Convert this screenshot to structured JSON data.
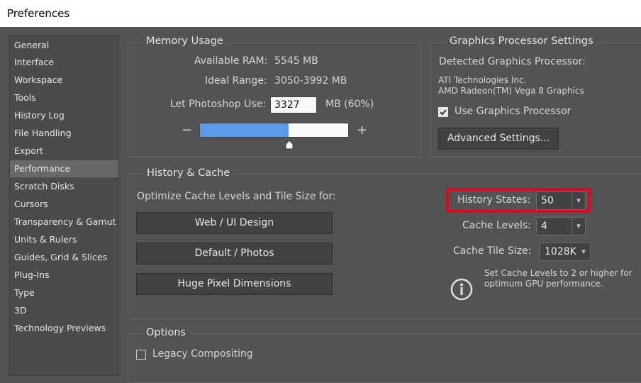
{
  "window": {
    "title": "Preferences"
  },
  "sidebar": {
    "items": [
      {
        "label": "General",
        "active": false
      },
      {
        "label": "Interface",
        "active": false
      },
      {
        "label": "Workspace",
        "active": false
      },
      {
        "label": "Tools",
        "active": false
      },
      {
        "label": "History Log",
        "active": false
      },
      {
        "label": "File Handling",
        "active": false
      },
      {
        "label": "Export",
        "active": false
      },
      {
        "label": "Performance",
        "active": true
      },
      {
        "label": "Scratch Disks",
        "active": false
      },
      {
        "label": "Cursors",
        "active": false
      },
      {
        "label": "Transparency & Gamut",
        "active": false
      },
      {
        "label": "Units & Rulers",
        "active": false
      },
      {
        "label": "Guides, Grid & Slices",
        "active": false
      },
      {
        "label": "Plug-Ins",
        "active": false
      },
      {
        "label": "Type",
        "active": false
      },
      {
        "label": "3D",
        "active": false
      },
      {
        "label": "Technology Previews",
        "active": false
      }
    ]
  },
  "memory": {
    "title": "Memory Usage",
    "available_label": "Available RAM:",
    "available_value": "5545 MB",
    "ideal_label": "Ideal Range:",
    "ideal_value": "3050-3992 MB",
    "let_use_label": "Let Photoshop Use:",
    "let_use_value": "3327",
    "let_use_unit": "MB (60%)",
    "slider_fraction": 0.6,
    "minus": "−",
    "plus": "+"
  },
  "gpu": {
    "title": "Graphics Processor Settings",
    "detected_label": "Detected Graphics Processor:",
    "vendor": "ATI Technologies Inc.",
    "model": "AMD Radeon(TM) Vega 8 Graphics",
    "use_gpu_label": "Use Graphics Processor",
    "use_gpu_checked": true,
    "advanced_label": "Advanced Settings..."
  },
  "history_cache": {
    "title": "History & Cache",
    "optimize_label": "Optimize Cache Levels and Tile Size for:",
    "preset_buttons": [
      "Web / UI Design",
      "Default / Photos",
      "Huge Pixel Dimensions"
    ],
    "history_states_label": "History States:",
    "history_states_value": "50",
    "cache_levels_label": "Cache Levels:",
    "cache_levels_value": "4",
    "tile_size_label": "Cache Tile Size:",
    "tile_size_value": "1028K",
    "info_line1": "Set Cache Levels to 2 or higher for",
    "info_line2": "optimum GPU performance."
  },
  "options": {
    "title": "Options",
    "legacy_label": "Legacy Compositing",
    "legacy_checked": false
  },
  "colors": {
    "background": "#535353",
    "highlight": "#e8001c",
    "slider_fill": "#5b9bea"
  }
}
